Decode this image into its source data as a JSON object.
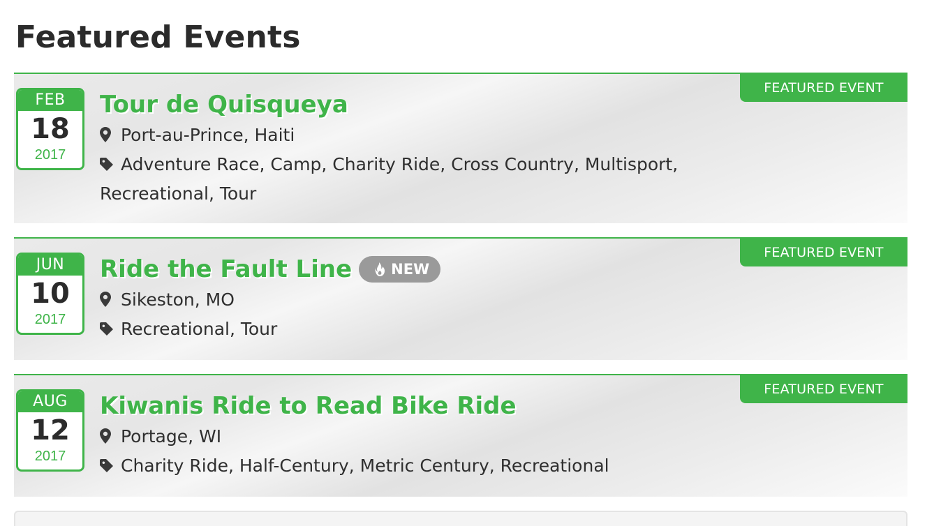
{
  "page": {
    "heading": "Featured Events"
  },
  "colors": {
    "accent": "#3fb449",
    "badge_gray": "#9a9a9a",
    "text_dark": "#2b2b2b"
  },
  "events": [
    {
      "ribbon": "FEATURED EVENT",
      "month": "FEB",
      "day": "18",
      "year": "2017",
      "title": "Tour de Quisqueya",
      "location": "Port-au-Prince, Haiti",
      "location_icon": "map-marker-icon",
      "tags_icon": "tag-icon",
      "tags_text": "Adventure Race, Camp, Charity Ride, Cross Country, Multisport, Recreational, Tour"
    },
    {
      "ribbon": "FEATURED EVENT",
      "month": "JUN",
      "day": "10",
      "year": "2017",
      "title": "Ride the Fault Line",
      "badge": {
        "label": "NEW",
        "icon": "fire-icon"
      },
      "location": "Sikeston, MO",
      "location_icon": "map-marker-icon",
      "tags_icon": "tag-icon",
      "tags_text": "Recreational, Tour"
    },
    {
      "ribbon": "FEATURED EVENT",
      "month": "AUG",
      "day": "12",
      "year": "2017",
      "title": "Kiwanis Ride to Read Bike Ride",
      "location": "Portage, WI",
      "location_icon": "map-marker-icon",
      "tags_icon": "tag-icon",
      "tags_text": "Charity Ride, Half-Century, Metric Century, Recreational"
    }
  ]
}
